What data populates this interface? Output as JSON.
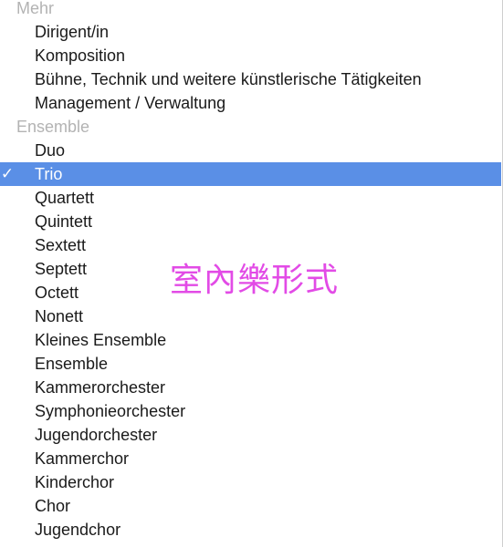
{
  "menu": {
    "sections": [
      {
        "header": "Mehr",
        "items": [
          {
            "label": "Dirigent/in"
          },
          {
            "label": "Komposition"
          },
          {
            "label": "Bühne, Technik und weitere künstlerische Tätigkeiten"
          },
          {
            "label": "Management / Verwaltung"
          }
        ]
      },
      {
        "header": "Ensemble",
        "items": [
          {
            "label": "Duo"
          },
          {
            "label": "Trio",
            "selected": true,
            "check": "✓"
          },
          {
            "label": "Quartett"
          },
          {
            "label": "Quintett"
          },
          {
            "label": "Sextett"
          },
          {
            "label": "Septett"
          },
          {
            "label": "Octett"
          },
          {
            "label": "Nonett"
          },
          {
            "label": "Kleines Ensemble"
          },
          {
            "label": "Ensemble"
          },
          {
            "label": "Kammerorchester"
          },
          {
            "label": "Symphonieorchester"
          },
          {
            "label": "Jugendorchester"
          },
          {
            "label": "Kammerchor"
          },
          {
            "label": "Kinderchor"
          },
          {
            "label": "Chor"
          },
          {
            "label": "Jugendchor"
          }
        ]
      }
    ]
  },
  "overlay": {
    "text": "室內樂形式",
    "color": "#e24be6"
  },
  "colors": {
    "selection_background": "#5a8fe6",
    "header_text": "#b3b3b3",
    "item_text": "#1a1a1a"
  }
}
